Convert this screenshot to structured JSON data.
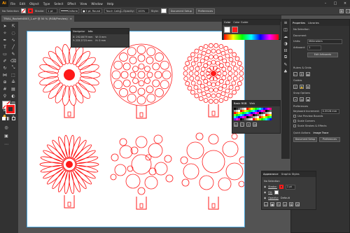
{
  "app": {
    "logo": "Ai"
  },
  "menu": [
    "File",
    "Edit",
    "Object",
    "Type",
    "Select",
    "Effect",
    "View",
    "Window",
    "Help"
  ],
  "control_bar": {
    "selection_label": "No Selection",
    "stroke_label": "Stroke:",
    "stroke_value": "1 pt",
    "uniform_label": "Uniform",
    "brush_label": "5 pt. Round",
    "style_label": "Touch Callig...",
    "opacity_label": "Opacity:",
    "opacity_value": "100%",
    "style2_label": "Style:",
    "doc_setup": "Document Setup",
    "preferences": "Preferences"
  },
  "doc_tab": {
    "title": "TRIAL_Rachelt4803_1.ai* @ 50 % (RGB/Preview)",
    "close": "×"
  },
  "navigator_panel": {
    "tab1": "Navigator",
    "tab2": "Info",
    "x": "252.8479 mm",
    "y": "233.2723 mm",
    "w": "0 mm",
    "h": "0 mm"
  },
  "color_panel": {
    "tab1": "Color",
    "tab2": "Color Guide"
  },
  "swatch_panel": {
    "tab1": "Basic RGB",
    "tab2": "Web"
  },
  "properties_panel": {
    "tab1": "Properties",
    "tab2": "Libraries",
    "no_selection": "No Selection",
    "document": "Document",
    "units_label": "Units:",
    "units_value": "Millimeters",
    "artboard_label": "Artboard:",
    "artboard_value": "1",
    "edit_artboards": "Edit Artboards",
    "ruler_grids": "Rulers & Grids",
    "guides": "Guides",
    "snap_options": "Snap Options",
    "preferences": "Preferences",
    "keyboard_increment_label": "Keyboard Increment:",
    "keyboard_increment_value": "0.3528 mm",
    "use_preview_bounds": "Use Preview Bounds",
    "scale_corners": "Scale Corners",
    "scale_strokes": "Scale Strokes & Effects",
    "quick_actions": "Quick Actions",
    "image_trace": "Image Trace",
    "document_setup": "Document Setup",
    "preferences_btn": "Preferences"
  },
  "appearance_panel": {
    "tab1": "Appearance",
    "tab2": "Graphic Styles",
    "no_selection": "No Selection",
    "stroke_label": "Stroke:",
    "stroke_value": "1 pt",
    "fill_label": "Fill:",
    "opacity_label": "Opacity:",
    "opacity_value": "Default"
  },
  "colors": {
    "accent": "#ff1a1a",
    "artboard_border": "#46a3d9",
    "bg": "#535353"
  }
}
